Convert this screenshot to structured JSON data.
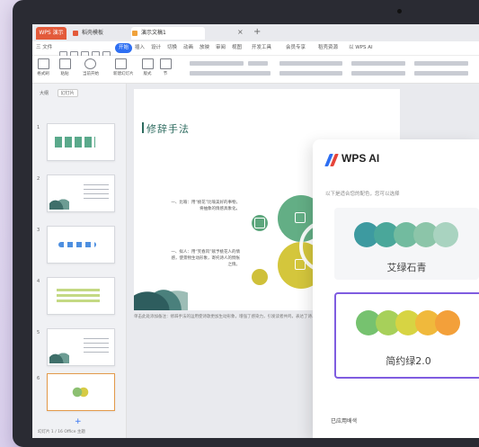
{
  "tabs": {
    "brand": "WPS 演示",
    "t2": "稻壳模板",
    "t3": "演示文稿1",
    "close": "×",
    "add": "+"
  },
  "menu": {
    "file": "三 文件",
    "items": [
      "开始",
      "插入",
      "设计",
      "切换",
      "动画",
      "放映",
      "审阅",
      "视图",
      "开发工具",
      "会员专享",
      "稻壳资源",
      "以 WPS AI"
    ]
  },
  "ribbon": {
    "buttons": [
      "格式刷",
      "粘贴",
      "当前开始",
      "新建幻灯片",
      "版式",
      "节"
    ]
  },
  "panel": {
    "tab_a": "大纲",
    "tab_b": "幻灯片",
    "slide_numbers": [
      "1",
      "2",
      "3",
      "4",
      "5",
      "6"
    ],
    "add": "+",
    "status": "幻灯片 1 / 16   Office 主题"
  },
  "slide": {
    "title": "修辞手法",
    "para1": "一、比喻：用“桃花”比喻美好的事物，将抽象的情感具象化。",
    "para2": "一、拟人：用“笑春风”赋予桃花人的情感，使景物生动形象，寄托诗人的惆怅之情。",
    "notes": "单击此处添加备注：修辞手法的运用使诗歌更加生动形象，增强了感染力，引发读者共鸣，表达了诗人对往事的怀念之情。"
  },
  "ai": {
    "title": "WPS AI",
    "hint": "以下是适合您的配色，您可以选择",
    "cards": [
      {
        "name": "艾绿石青",
        "colors": [
          "#3d9aa0",
          "#4aa79a",
          "#72bb9f",
          "#8cc5a9",
          "#a9d3c0"
        ]
      },
      {
        "name": "简约绿2.0",
        "colors": [
          "#76c26f",
          "#a7d05a",
          "#d7d443",
          "#f0b93c",
          "#f3a03a"
        ]
      }
    ],
    "recent": "已应用배색"
  }
}
